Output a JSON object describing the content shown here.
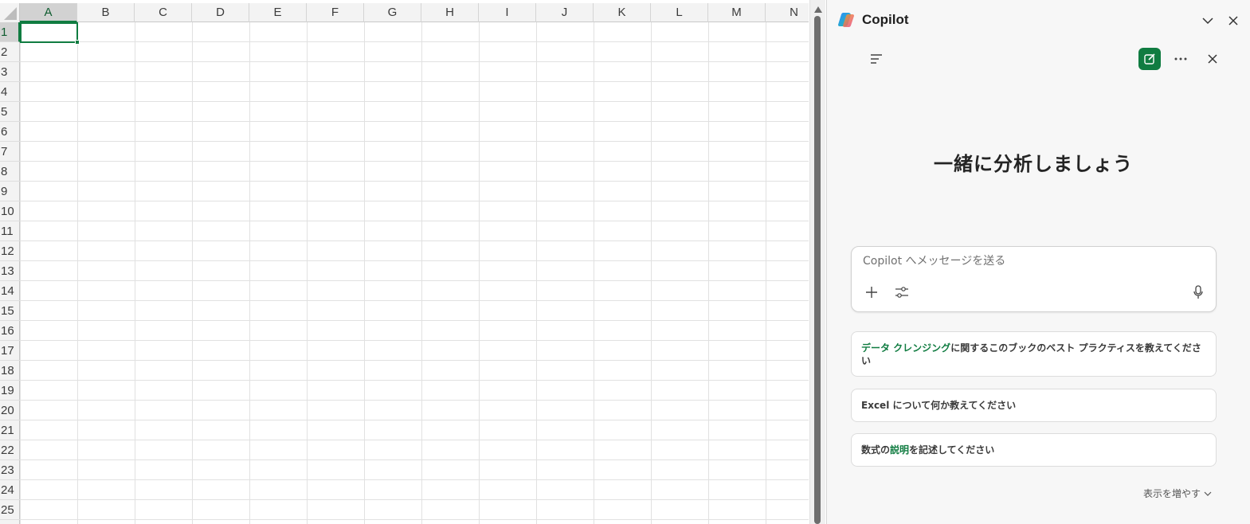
{
  "spreadsheet": {
    "columns": [
      "A",
      "B",
      "C",
      "D",
      "E",
      "F",
      "G",
      "H",
      "I",
      "J",
      "K",
      "L",
      "M",
      "N"
    ],
    "rows": [
      "1",
      "2",
      "3",
      "4",
      "5",
      "6",
      "7",
      "8",
      "9",
      "10",
      "11",
      "12",
      "13",
      "14",
      "15",
      "16",
      "17",
      "18",
      "19",
      "20",
      "21",
      "22",
      "23",
      "24",
      "25"
    ],
    "selected_column": "A",
    "selected_row": "1",
    "accent_color": "#107c41"
  },
  "copilot": {
    "title": "Copilot",
    "welcome_heading": "一緒に分析しましょう",
    "composer_placeholder": "Copilot へメッセージを送る",
    "suggestions": [
      {
        "highlight": "データ クレンジング",
        "pre": "",
        "post": "に関するこのブックのベスト プラクティスを教えてください"
      },
      {
        "highlight": "",
        "pre": "Excel について何か教えてください",
        "post": ""
      },
      {
        "highlight": "説明",
        "pre": "数式の",
        "post": "を記述してください"
      }
    ],
    "show_more_label": "表示を増やす",
    "icons": {
      "logo": "copilot-logo-icon",
      "collapse": "chevron-down-icon",
      "close_pane": "close-icon",
      "menu": "menu-icon",
      "new_chat": "new-chat-icon",
      "more": "more-icon",
      "close_chat": "close-icon",
      "attach": "plus-icon",
      "settings": "sliders-icon",
      "mic": "microphone-icon"
    },
    "brand_color": "#107c41"
  }
}
